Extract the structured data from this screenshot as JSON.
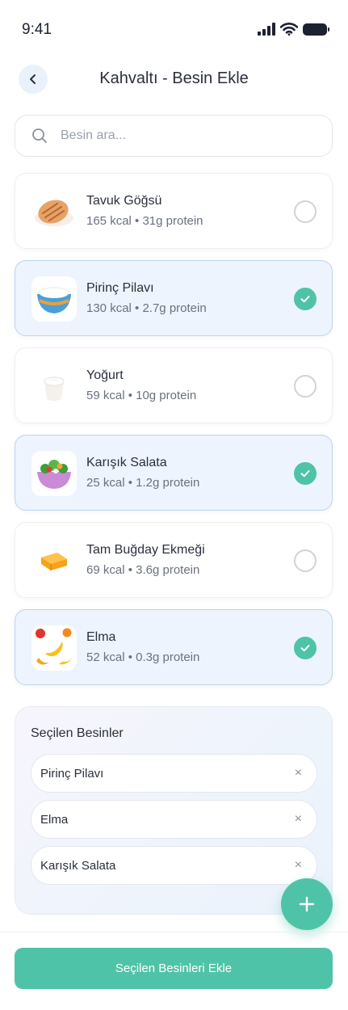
{
  "status_bar": {
    "time": "9:41"
  },
  "header": {
    "title": "Kahvaltı - Besin Ekle"
  },
  "search": {
    "placeholder": "Besin ara..."
  },
  "foods": [
    {
      "name": "Tavuk Göğsü",
      "meta": "165 kcal • 31g protein",
      "selected": false,
      "icon": "chicken-icon"
    },
    {
      "name": "Pirinç Pilavı",
      "meta": "130 kcal • 2.7g protein",
      "selected": true,
      "icon": "rice-bowl-icon"
    },
    {
      "name": "Yoğurt",
      "meta": "59 kcal • 10g protein",
      "selected": false,
      "icon": "yogurt-cup-icon"
    },
    {
      "name": "Karışık Salata",
      "meta": "25 kcal • 1.2g protein",
      "selected": true,
      "icon": "salad-bowl-icon"
    },
    {
      "name": "Tam Buğday Ekmeği",
      "meta": "69 kcal • 3.6g protein",
      "selected": false,
      "icon": "bread-icon"
    },
    {
      "name": "Elma",
      "meta": "52 kcal • 0.3g protein",
      "selected": true,
      "icon": "fruits-icon"
    }
  ],
  "selected_panel": {
    "title": "Seçilen Besinler",
    "chips": [
      {
        "label": "Pirinç Pilavı"
      },
      {
        "label": "Elma"
      },
      {
        "label": "Karışık Salata"
      }
    ],
    "remove_glyph": "×"
  },
  "fab": {
    "icon": "plus-icon"
  },
  "cta": {
    "label": "Seçilen Besinleri Ekle"
  },
  "colors": {
    "accent": "#4fc3a7",
    "selected_bg": "#edf4fd",
    "selected_border": "#bcd4f0"
  }
}
